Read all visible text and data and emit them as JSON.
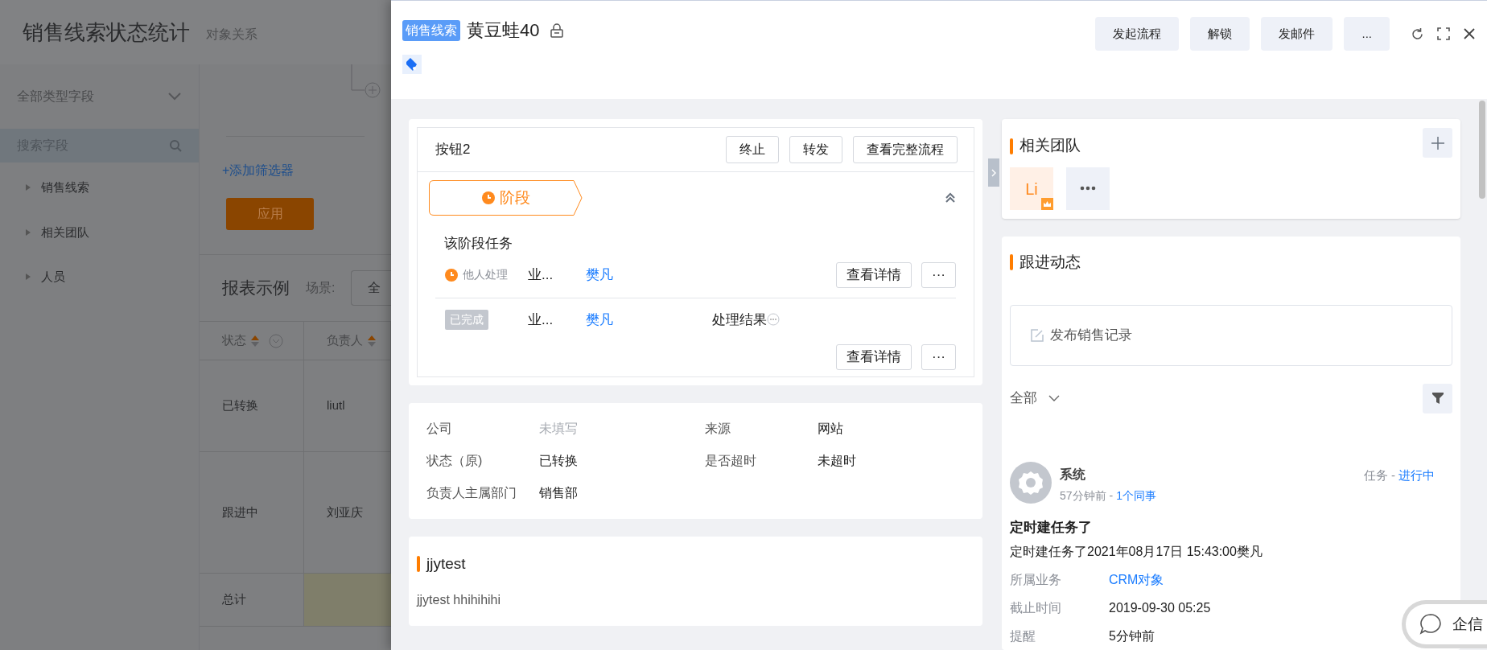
{
  "background_page": {
    "title": "销售线索状态统计",
    "subtitle": "对象关系",
    "type_select": "全部类型字段",
    "search": {
      "placeholder": "搜索字段"
    },
    "tree_items": [
      {
        "label": "销售线索",
        "expanded": false
      },
      {
        "label": "相关团队",
        "expanded": false
      },
      {
        "label": "人员",
        "expanded": false
      }
    ],
    "add_filter": "+添加筛选器",
    "apply_button": "应用",
    "report_title": "报表示例",
    "scene_label": "场景:",
    "scene_value": "全",
    "table": {
      "columns": [
        {
          "label": "状态",
          "filter": true
        },
        {
          "label": "负责人",
          "filter": false
        }
      ],
      "rows": [
        [
          "已转换",
          "liutl"
        ],
        [
          "跟进中",
          "刘亚庆"
        ]
      ],
      "total": "总计"
    }
  },
  "drawer": {
    "tag": "销售线索",
    "title": "黄豆蛙40",
    "locked": true,
    "actions": [
      "发起流程",
      "解锁",
      "发邮件",
      "..."
    ],
    "process_card": {
      "title": "按钮2",
      "buttons": [
        "终止",
        "转发",
        "查看完整流程"
      ],
      "stage": {
        "label": "阶段",
        "expanded": true
      },
      "tasks_title": "该阶段任务",
      "tasks": [
        {
          "kind": "pending",
          "status": "他人处理",
          "business": "业...",
          "assignee": "樊凡",
          "actions": [
            "查看详情",
            "···"
          ]
        },
        {
          "kind": "done",
          "status": "已完成",
          "business": "业...",
          "assignee": "樊凡",
          "result": "处理结果",
          "actions": [
            "查看详情",
            "···"
          ]
        }
      ]
    },
    "fields": [
      {
        "label": "公司",
        "value": "未填写",
        "empty": true
      },
      {
        "label": "来源",
        "value": "网站",
        "empty": false
      },
      {
        "label": "状态（原)",
        "value": "已转换",
        "empty": false
      },
      {
        "label": "是否超时",
        "value": "未超时",
        "empty": false
      },
      {
        "label": "负责人主属部门",
        "value": "销售部",
        "empty": false
      }
    ],
    "text_card": {
      "title": "jjytest",
      "text": "jjytest hhihihihi"
    },
    "team": {
      "title": "相关团队",
      "members": [
        {
          "initials": "Li",
          "owner": true
        }
      ]
    },
    "followup": {
      "title": "跟进动态",
      "publish": "发布销售记录",
      "filter": "全部",
      "entries": [
        {
          "author": "系统",
          "time": "57分钟前 -",
          "colleagues": "1个同事",
          "type": "任务 -",
          "status": "进行中",
          "title": "定时建任务了",
          "body": "定时建任务了2021年08月17日 15:43:00樊凡",
          "fields": [
            {
              "label": "所属业务",
              "value": "CRM对象",
              "link": true
            },
            {
              "label": "截止时间",
              "value": "2019-09-30 05:25",
              "link": false
            },
            {
              "label": "提醒",
              "value": "5分钟前",
              "link": false
            }
          ]
        }
      ]
    }
  },
  "chat": {
    "label": "企信"
  }
}
